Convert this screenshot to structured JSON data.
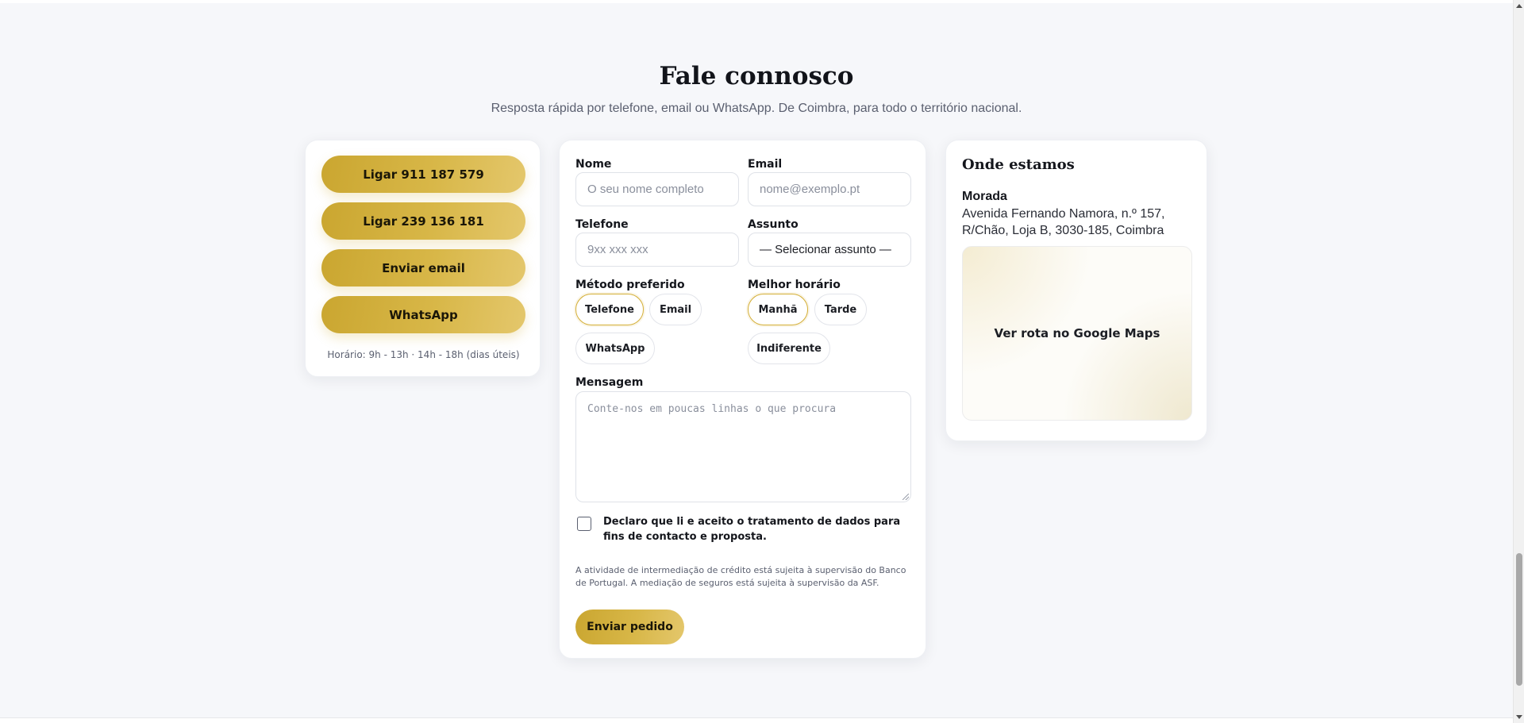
{
  "section": {
    "title": "Fale connosco",
    "subtitle": "Resposta rápida por telefone, email ou WhatsApp. De Coimbra, para todo o território nacional."
  },
  "contact_card": {
    "buttons": [
      "Ligar 911 187 579",
      "Ligar 239 136 181",
      "Enviar email",
      "WhatsApp"
    ],
    "hours": "Horário: 9h - 13h · 14h - 18h (dias úteis)"
  },
  "form": {
    "name": {
      "label": "Nome",
      "placeholder": "O seu nome completo",
      "value": ""
    },
    "email": {
      "label": "Email",
      "placeholder": "nome@exemplo.pt",
      "value": ""
    },
    "phone": {
      "label": "Telefone",
      "placeholder": "9xx xxx xxx",
      "value": ""
    },
    "subject": {
      "label": "Assunto",
      "selected": "— Selecionar assunto —"
    },
    "method": {
      "label": "Método preferido",
      "options": [
        "Telefone",
        "Email",
        "WhatsApp"
      ],
      "selected": "Telefone"
    },
    "time": {
      "label": "Melhor horário",
      "options": [
        "Manhã",
        "Tarde",
        "Indiferente"
      ],
      "selected": "Manhã"
    },
    "message": {
      "label": "Mensagem",
      "placeholder": "Conte-nos em poucas linhas o que procura",
      "value": ""
    },
    "consent": {
      "text": "Declaro que li e aceito o tratamento de dados para fins de contacto e proposta.",
      "checked": false
    },
    "legal": "A atividade de intermediação de crédito está sujeita à supervisão do Banco de Portugal. A mediação de seguros está sujeita à supervisão da ASF.",
    "submit_label": "Enviar pedido"
  },
  "location_card": {
    "title": "Onde estamos",
    "address_label": "Morada",
    "address": "Avenida Fernando Namora, n.º 157, R/Chão, Loja B, 3030-185, Coimbra",
    "map_link": "Ver rota no Google Maps"
  },
  "colors": {
    "accent_gold": "#d4af37",
    "background": "#f6f7fa",
    "text": "#14161c"
  }
}
